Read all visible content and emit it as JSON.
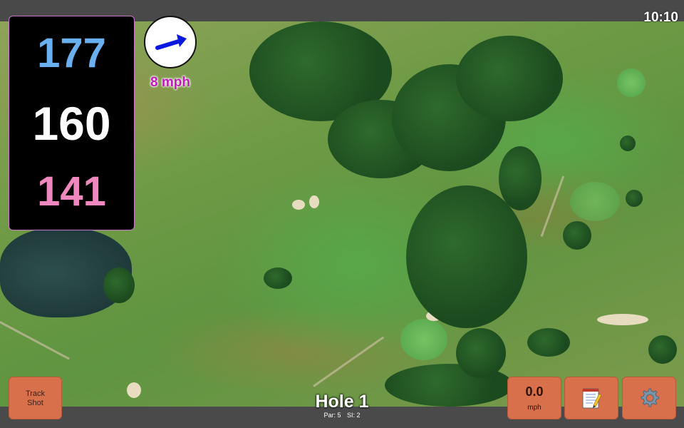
{
  "status": {
    "time": "10:10"
  },
  "distances": {
    "back": "177",
    "middle": "160",
    "front": "141"
  },
  "wind": {
    "speed_label": "8 mph",
    "direction_icon": "wind-arrow-icon"
  },
  "hole": {
    "title": "Hole 1",
    "par": "Par: 5",
    "si": "SI: 2"
  },
  "buttons": {
    "track_shot_line1": "Track",
    "track_shot_line2": "Shot",
    "wind_value": "0.0",
    "wind_unit": "mph",
    "notes_icon": "notepad-icon",
    "settings_icon": "gear-icon"
  },
  "colors": {
    "back_distance": "#6ab0f0",
    "middle_distance": "#ffffff",
    "front_distance": "#f088c0",
    "wind_speed": "#c01ab8",
    "button": "#d9704c"
  }
}
